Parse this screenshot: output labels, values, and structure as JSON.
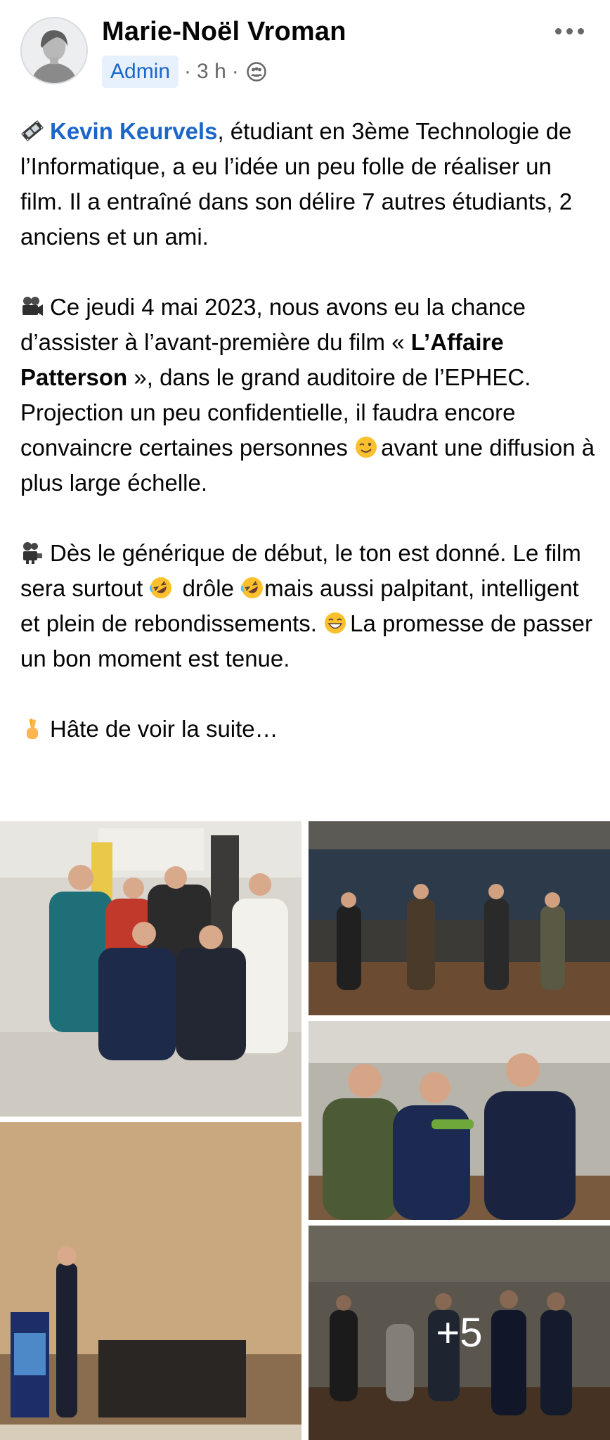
{
  "header": {
    "author": "Marie-Noël Vroman",
    "badge": "Admin",
    "time": "3 h",
    "separator": "·",
    "privacy_icon": "friends-group-icon",
    "menu_icon": "more-dots-icon"
  },
  "post": {
    "p1": {
      "icon": "film-strip-emoji",
      "mention": "Kevin Keurvels",
      "text": ", étudiant en 3ème Technologie de l’Informatique, a eu l’idée un peu folle de réaliser un film. Il a entraîné dans son délire 7 autres étudiants, 2 anciens et un ami."
    },
    "p2": {
      "icon": "movie-camera-emoji",
      "text_a": "Ce jeudi 4 mai 2023, nous avons eu la chance d’assister à l’avant-première du film « ",
      "bold": "L’Affaire Patterson",
      "text_b": " », dans le grand auditoire de l’EPHEC. Projection un peu confidentielle, il faudra encore convaincre certaines personnes ",
      "emoji_wink": "winking-face-emoji",
      "text_c": "avant une diffusion à plus large échelle."
    },
    "p3": {
      "icon": "film-projector-emoji",
      "text_a": "Dès le générique de début, le ton est donné. Le film sera surtout ",
      "emoji_laugh": "rolling-laughing-emoji",
      "text_b": " drôle ",
      "text_c": "mais aussi palpitant, intelligent et plein de rebondissements. ",
      "emoji_grin": "grinning-face-emoji",
      "text_d": "La promesse de passer un bon moment est tenue."
    },
    "p4": {
      "icon": "crossed-fingers-emoji",
      "text": "Hâte de voir la suite…"
    }
  },
  "photos": {
    "more_count": "+5",
    "colors": {
      "link": "#1b66c9",
      "badge_bg": "#e7f0fd",
      "meta": "#65676b"
    }
  }
}
